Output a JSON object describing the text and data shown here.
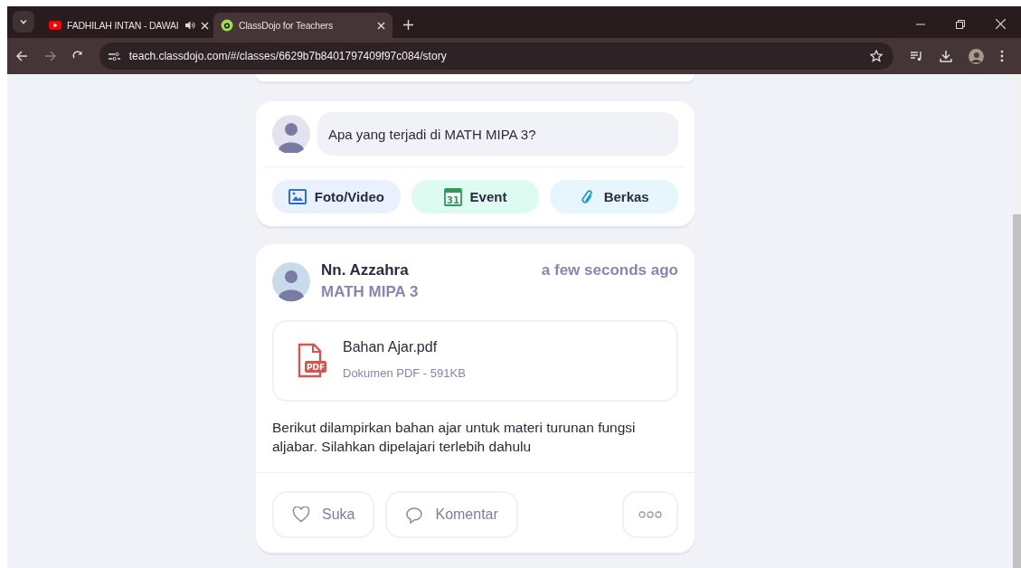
{
  "tabs": [
    {
      "title": "FADHILAH INTAN - DAWAI",
      "selected": false,
      "audio": true,
      "kind": "video"
    },
    {
      "title": "ClassDojo for Teachers",
      "selected": true,
      "audio": false,
      "kind": "app"
    }
  ],
  "address_bar": {
    "url": "teach.classdojo.com/#/classes/6629b7b8401797409f97c084/story"
  },
  "composer": {
    "placeholder": "Apa yang terjadi di MATH MIPA 3?",
    "actions": [
      {
        "kind": "photo",
        "label": "Foto/Video"
      },
      {
        "kind": "event",
        "label": "Event",
        "icon_text": "31"
      },
      {
        "kind": "file",
        "label": "Berkas"
      }
    ]
  },
  "post": {
    "author": "Nn. Azzahra",
    "class_name": "MATH MIPA 3",
    "time": "a few seconds ago",
    "attachment": {
      "name": "Bahan Ajar.pdf",
      "meta": "Dokumen PDF - 591KB",
      "icon_text": "PDF"
    },
    "body": "Berikut dilampirkan bahan ajar untuk materi turunan fungsi aljabar. Silahkan dipelajari terlebih dahulu",
    "actions": [
      {
        "kind": "like",
        "label": "Suka"
      },
      {
        "kind": "comment",
        "label": "Komentar"
      }
    ]
  }
}
